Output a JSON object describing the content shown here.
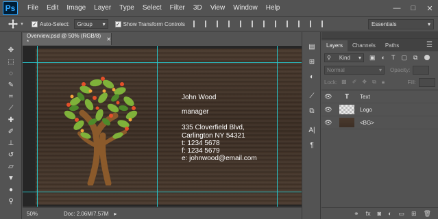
{
  "app": {
    "logo": "Ps"
  },
  "menu": [
    "File",
    "Edit",
    "Image",
    "Layer",
    "Type",
    "Select",
    "Filter",
    "3D",
    "View",
    "Window",
    "Help"
  ],
  "window_controls": [
    "—",
    "□",
    "✕"
  ],
  "options": {
    "auto_select_label": "Auto-Select:",
    "auto_select_value": "Group",
    "show_transform_label": "Show Transform Controls",
    "workspace": "Essentials"
  },
  "document": {
    "tab_title": "Overview.psd @ 50% (RGB/8) *",
    "zoom": "50%",
    "doc_info": "Doc: 2.06M/7.57M"
  },
  "card": {
    "name": "John Wood",
    "title": "manager",
    "address1": "335 Cloverfield Blvd,",
    "address2": "Carlington NY 54321",
    "tel": "t: 1234 5678",
    "fax": "f: 1234 5679",
    "email": "e: johnwood@email.com"
  },
  "layers_panel": {
    "tabs": [
      "Layers",
      "Channels",
      "Paths"
    ],
    "kind": "Kind",
    "blend_mode": "Normal",
    "opacity_label": "Opacity:",
    "lock_label": "Lock:",
    "fill_label": "Fill:",
    "layers": [
      {
        "name": "Text",
        "type": "text"
      },
      {
        "name": "Logo",
        "type": "image"
      },
      {
        "name": "<BG>",
        "type": "image"
      }
    ]
  },
  "colors": {
    "ui_bg": "#535353",
    "guide": "#27c3c8",
    "wood": "#3d2f25",
    "accent": "#31a8ff"
  }
}
